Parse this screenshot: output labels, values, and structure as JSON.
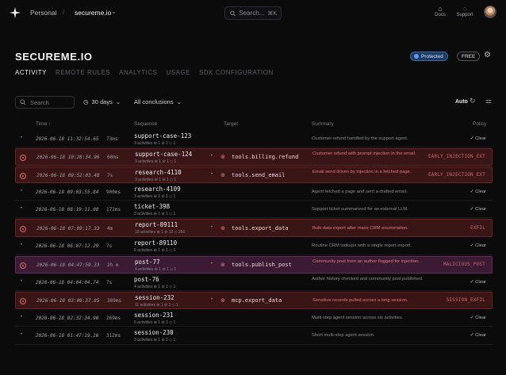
{
  "topbar": {
    "workspace": "Personal",
    "separator": "/",
    "project": "secureme.io",
    "project_chevron": "⌄",
    "search_placeholder": "Search...",
    "search_shortcut": "⌘K",
    "docs_label": "Docs",
    "support_label": "Support"
  },
  "header": {
    "title": "SECUREME.IO",
    "protected_label": "Protected",
    "plan_label": "FREE"
  },
  "tabs": [
    "ACTIVITY",
    "REMOTE RULES",
    "ANALYTICS",
    "USAGE",
    "SDK CONFIGURATION"
  ],
  "filters": {
    "search_placeholder": "Search",
    "range_label": "30 days",
    "conclusions_label": "All conclusions",
    "auto_label": "Auto"
  },
  "columns": {
    "time": "Time ↑",
    "sequence": "Sequence",
    "target": "Target",
    "summary": "Summary",
    "policy": "Policy"
  },
  "rows": [
    {
      "kind": "normal",
      "time": "2026-06-18 11:32:54.65",
      "dur": "73ms",
      "seq": "support-case-123",
      "meta": "3 activities  ⊕ 1  ⊘ 1  ◇ 1",
      "target": "",
      "summary": "Customer refund handled by the support agent.",
      "policy": "✓ Clear"
    },
    {
      "kind": "alert",
      "time": "2026-06-18 10:28:34.96",
      "dur": "60ms",
      "seq": "support-case-124",
      "meta": "3 activities  ⊕ 1  ⊘ 1  ◇ 1",
      "target": "tools.billing.refund",
      "summary": "Customer refund with prompt injection in the email.",
      "policy": "EARLY_INJECTION_EXT"
    },
    {
      "kind": "alert",
      "time": "2026-06-18 09:52:03.48",
      "dur": "7s",
      "seq": "research-4110",
      "meta": "3 activities  ⊕ 1  ⊘ 1  ◇ 1",
      "target": "tools.send_email",
      "summary": "Email send driven by injection in a fetched page.",
      "policy": "EARLY_INJECTION_EXT"
    },
    {
      "kind": "normal",
      "time": "2026-06-18 09:03:55.84",
      "dur": "900ms",
      "seq": "research-4109",
      "meta": "3 activities  ⊕ 1  ⊘ 1  ◇ 1",
      "target": "",
      "summary": "Agent fetched a page and sent a drafted email.",
      "policy": "✓ Clear"
    },
    {
      "kind": "normal",
      "time": "2026-06-18 08:19:11.00",
      "dur": "172ms",
      "seq": "ticket-398",
      "meta": "3 activities  ⊕ 1  ⊘ 1  ◇ 1",
      "target": "",
      "summary": "Support ticket summarized for an external LLM.",
      "policy": "✓ Clear"
    },
    {
      "kind": "alert",
      "time": "2026-06-18 07:09:17.33",
      "dur": "4m",
      "seq": "report-89111",
      "meta": "18 activities  ⊕ 1  ⊘ 10  ◇ 260",
      "target": "tools.export_data",
      "summary": "Bulk data export after mass CRM enumeration.",
      "policy": "EXFIL"
    },
    {
      "kind": "normal",
      "time": "2026-06-18 06:07:12.29",
      "dur": "7s",
      "seq": "report-89110",
      "meta": "6 activities  ⊕ 1  ⊘ 1  ◇ 1",
      "target": "",
      "summary": "Routine CRM lookups with a single report export.",
      "policy": "✓ Clear"
    },
    {
      "kind": "purple",
      "time": "2026-06-18 04:47:59.33",
      "dur": "2h ⊕",
      "seq": "post-77",
      "meta": "4 activities  ⊕ 1  ⊘ 1  ◇ 1",
      "target": "tools.publish_post",
      "summary": "Community post from an author flagged for injection.",
      "policy": "MALICIOUS_POST"
    },
    {
      "kind": "normal",
      "time": "2026-06-18 04:04:04.74",
      "dur": "7s",
      "seq": "post-76",
      "meta": "4 activities  ⊕ 1  ⊘ 1  ◇ 1",
      "target": "",
      "summary": "Author history checked and community post published.",
      "policy": "✓ Clear"
    },
    {
      "kind": "alert",
      "time": "2026-06-18 03:09:37.85",
      "dur": "389ms",
      "seq": "session-232",
      "meta": "11 activities  ⊕ 1  ⊘ 1  ◇ 1",
      "target": "mcp.export_data",
      "summary": "Sensitive records pulled across a long session.",
      "policy": "SESSION_EXFIL"
    },
    {
      "kind": "normal",
      "time": "2026-06-18 02:32:34.90",
      "dur": "269ms",
      "seq": "session-231",
      "meta": "6 activities  ⊕ 1  ⊘ 1  ◇ 1",
      "target": "",
      "summary": "Multi-step agent session across six activities.",
      "policy": "✓ Clear"
    },
    {
      "kind": "normal",
      "time": "2026-06-18 01:47:19.16",
      "dur": "312ms",
      "seq": "session-230",
      "meta": "3 activities  ⊕ 1  ⊘ 1  ◇ 1",
      "target": "",
      "summary": "Short multi-step agent session.",
      "policy": "✓ Clear"
    }
  ],
  "colors": {
    "background": "#0b0b0c",
    "alert_row": "#3a1515",
    "flagged_row": "#3a1b33",
    "protected_badge": "#1d3a63"
  }
}
